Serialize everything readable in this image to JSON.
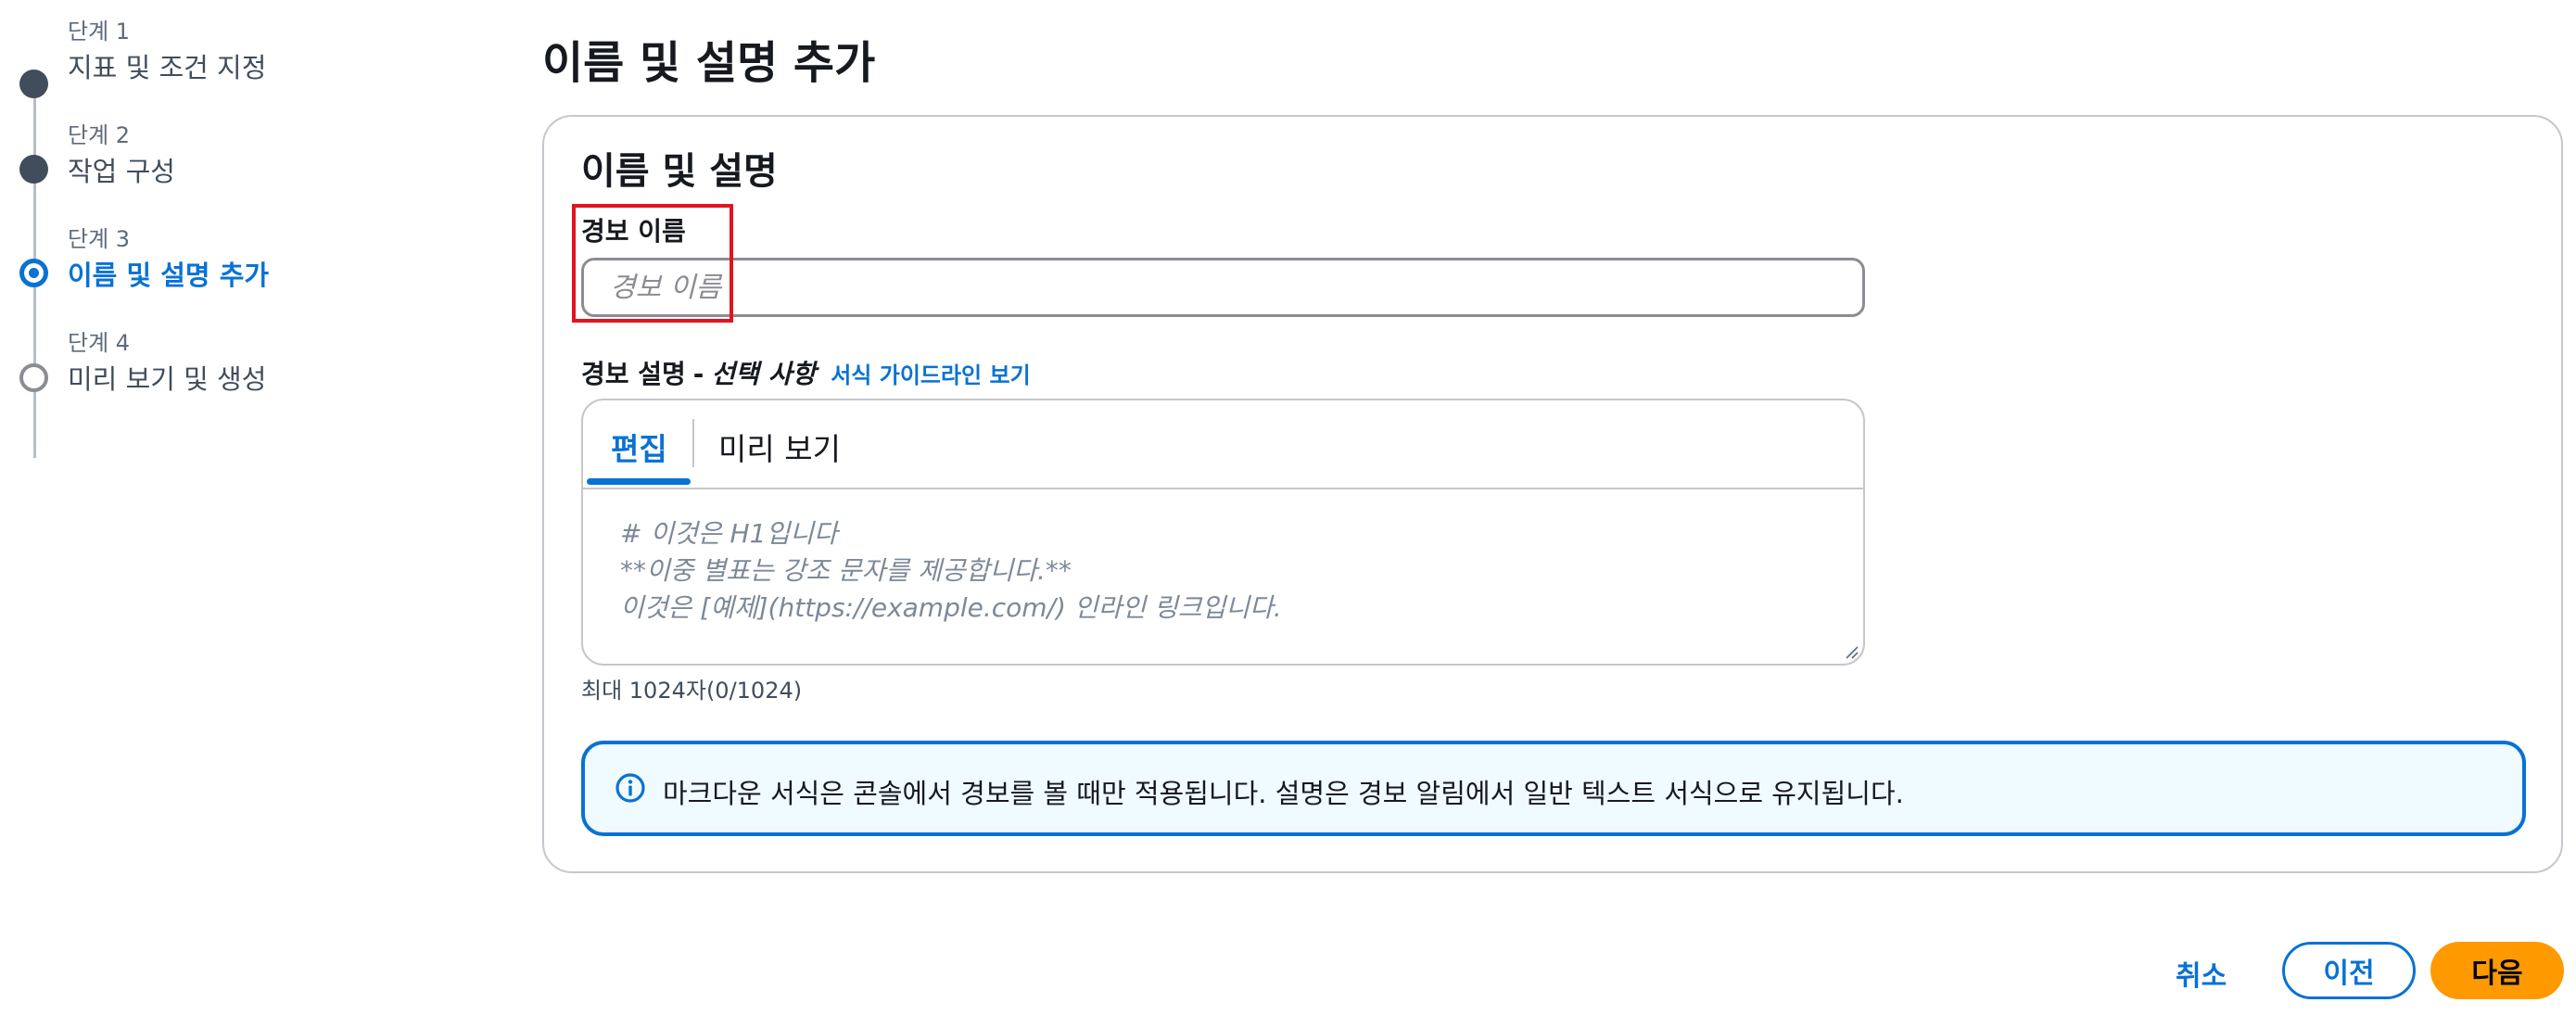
{
  "steps": [
    {
      "number": "단계 1",
      "title": "지표 및 조건 지정",
      "state": "complete"
    },
    {
      "number": "단계 2",
      "title": "작업 구성",
      "state": "complete"
    },
    {
      "number": "단계 3",
      "title": "이름 및 설명 추가",
      "state": "current"
    },
    {
      "number": "단계 4",
      "title": "미리 보기 및 생성",
      "state": "upcoming"
    }
  ],
  "page_title": "이름 및 설명 추가",
  "form": {
    "section_title": "이름 및 설명",
    "name_label": "경보 이름",
    "name_placeholder": "경보 이름",
    "name_value": "",
    "description_label": "경보 설명",
    "description_separator": "-",
    "description_optional": "선택 사항",
    "guidelines_link": "서식 가이드라인 보기",
    "tabs": [
      {
        "label": "편집",
        "selected": true
      },
      {
        "label": "미리 보기",
        "selected": false
      }
    ],
    "description_placeholder": "# 이것은 H1입니다\n**이중 별표는 강조 문자를 제공합니다.**\n이것은 [예제](https://example.com/) 인라인 링크입니다.",
    "char_count": "최대 1024자(0/1024)",
    "info_message": "마크다운 서식은 콘솔에서 경보를 볼 때만 적용됩니다. 설명은 경보 알림에서 일반 텍스트 서식으로 유지됩니다."
  },
  "buttons": {
    "cancel": "취소",
    "previous": "이전",
    "next": "다음"
  },
  "colors": {
    "accent": "#0972d3",
    "primary_button": "#ff9900",
    "highlight": "#e2141f",
    "info_background": "#f0fbff"
  },
  "icons": {
    "info": "info-icon",
    "resize": "resize-handle-icon"
  }
}
